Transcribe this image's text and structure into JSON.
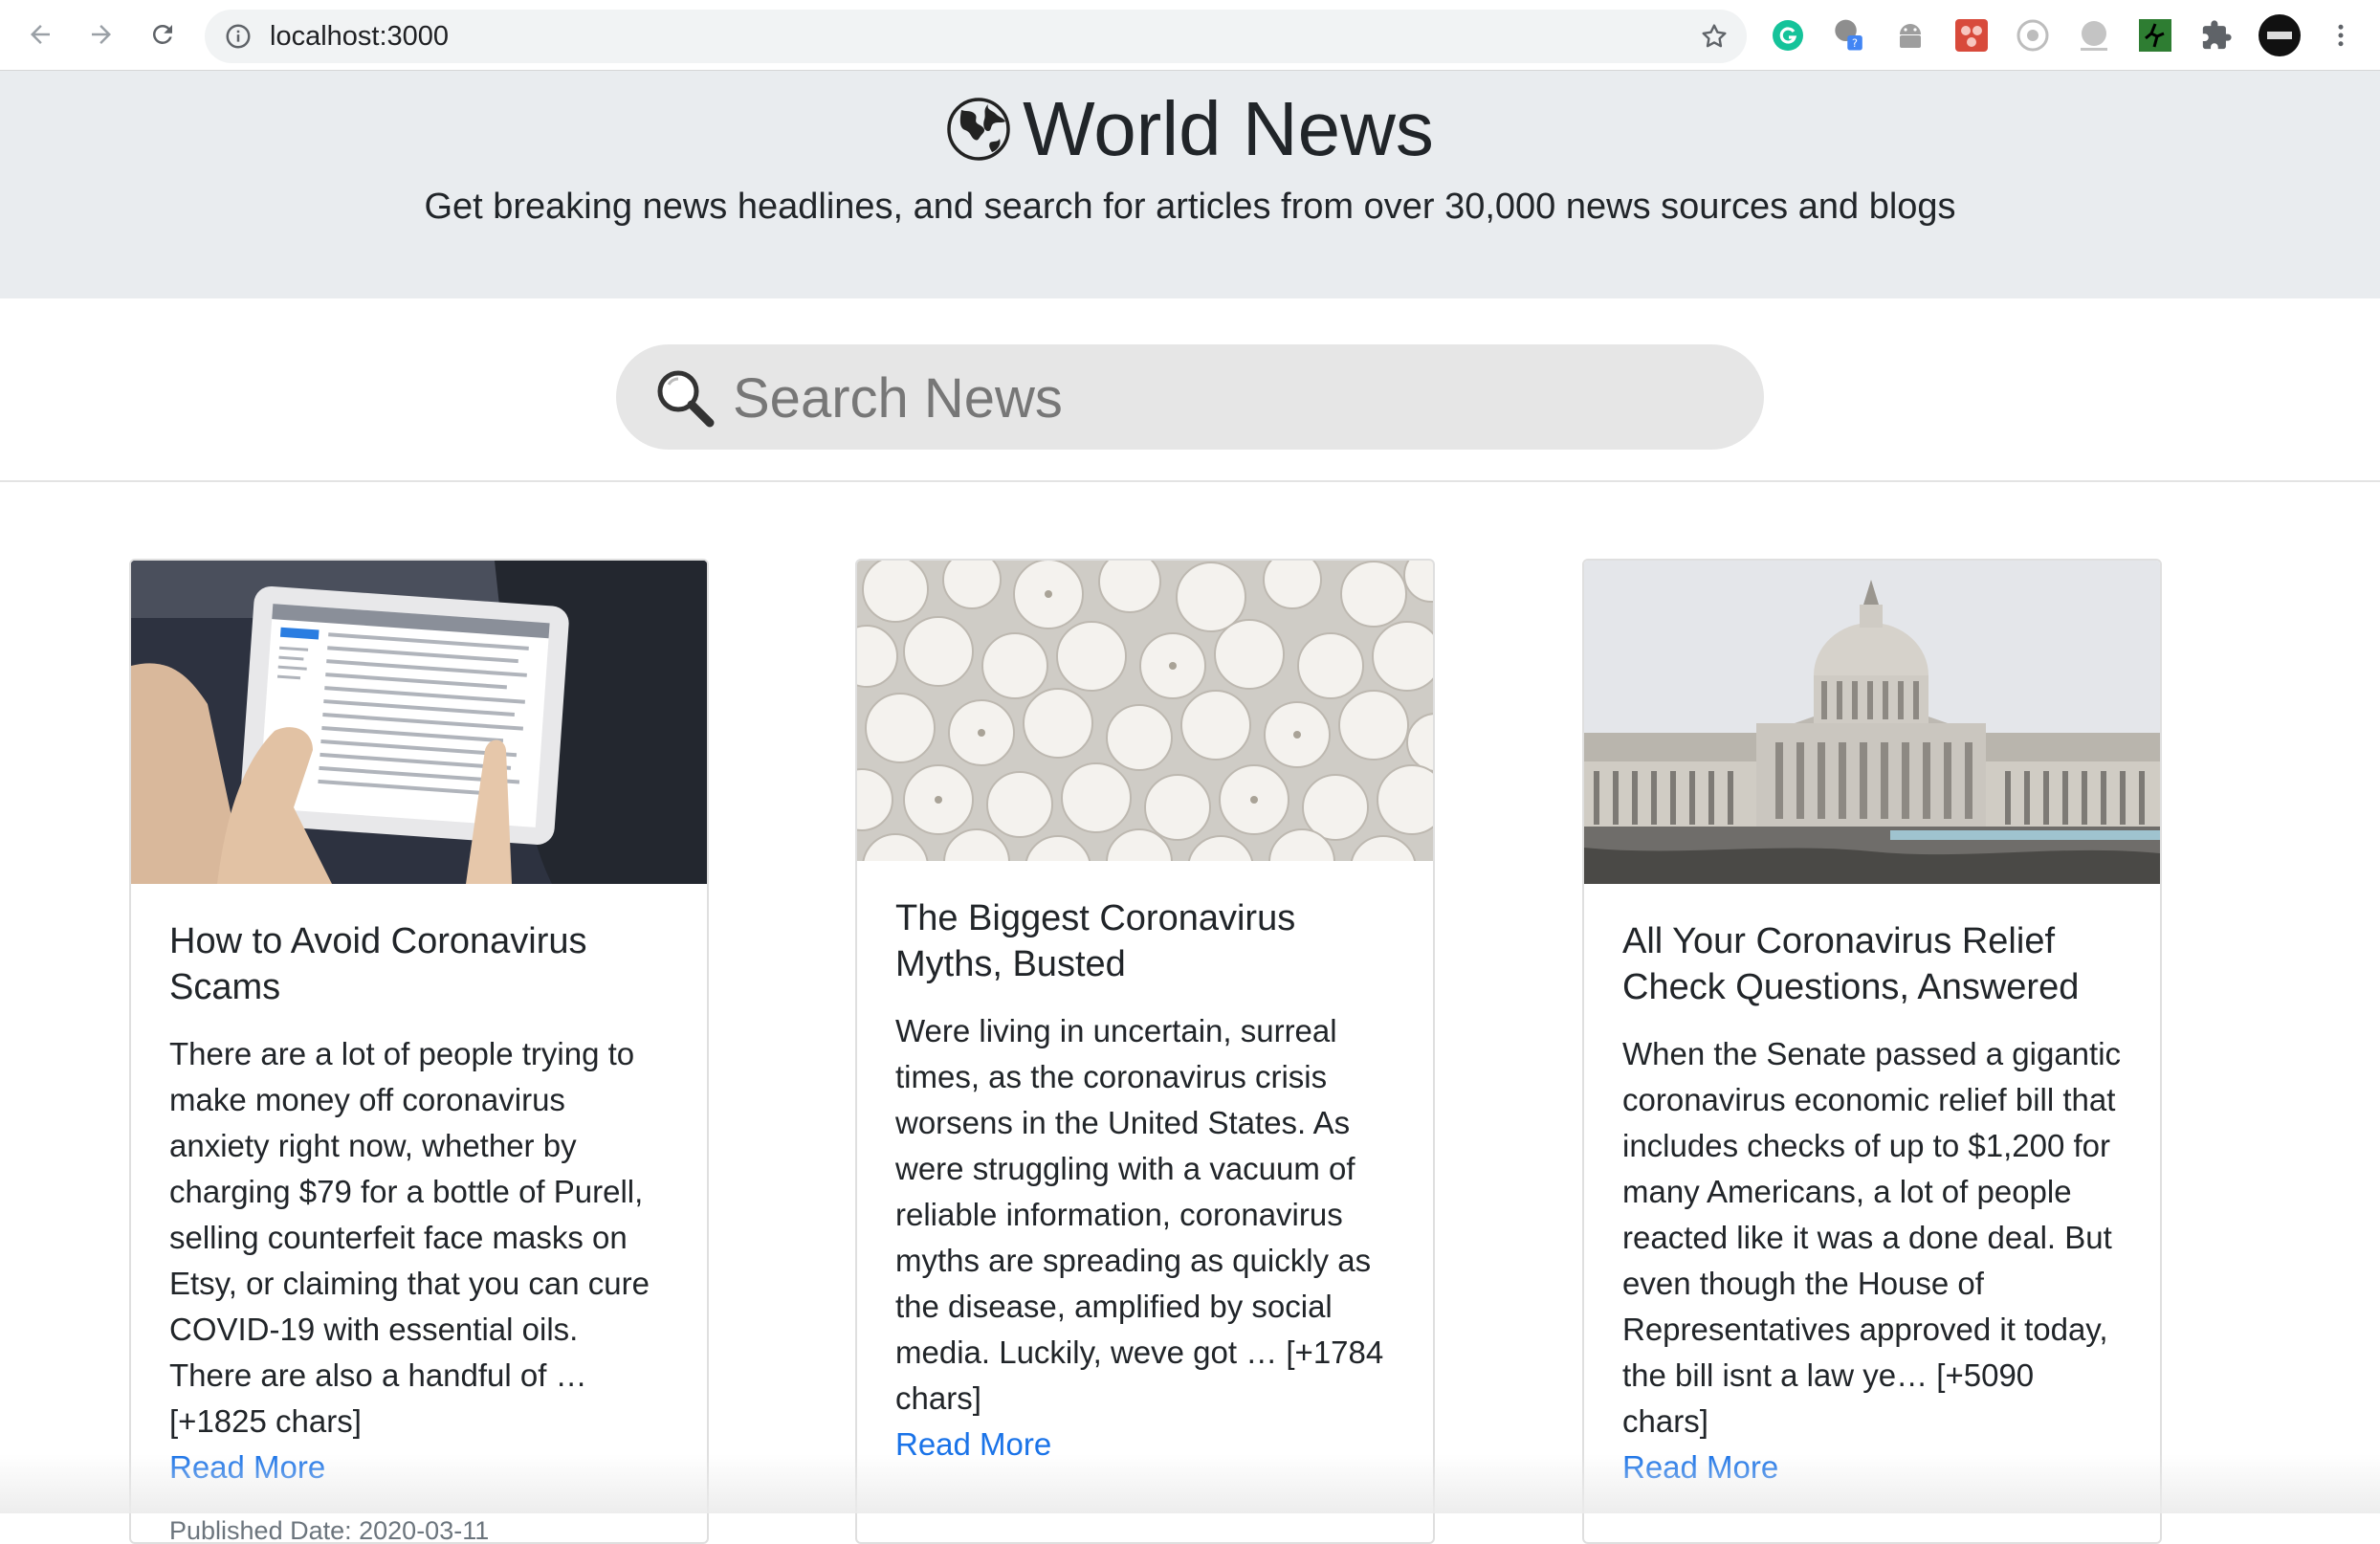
{
  "browser": {
    "url": "localhost:3000"
  },
  "header": {
    "title": "World News",
    "tagline": "Get breaking news headlines, and search for articles from over 30,000 news sources and blogs"
  },
  "search": {
    "placeholder": "Search News",
    "value": ""
  },
  "articles": [
    {
      "title": "How to Avoid Coronavirus Scams",
      "description": "There are a lot of people trying to make money off coronavirus anxiety right now, whether by charging $79 for a bottle of Purell, selling counterfeit face masks on Etsy, or claiming that you can cure COVID-19 with essential oils. There are also a handful of … [+1825 chars]",
      "link_label": "Read More",
      "published": "Published Date: 2020-03-11"
    },
    {
      "title": "The Biggest Coronavirus Myths, Busted",
      "description": "Were living in uncertain, surreal times, as the coronavirus crisis worsens in the United States. As were struggling with a vacuum of reliable information, coronavirus myths are spreading as quickly as the disease, amplified by social media. Luckily, weve got … [+1784 chars]",
      "link_label": "Read More",
      "published": ""
    },
    {
      "title": "All Your Coronavirus Relief Check Questions, Answered",
      "description": "When the Senate passed a gigantic coronavirus economic relief bill that includes checks of up to $1,200 for many Americans, a lot of people reacted like it was a done deal. But even though the House of Representatives approved it today, the bill isnt a law ye… [+5090 chars]",
      "link_label": "Read More",
      "published": ""
    }
  ],
  "colors": {
    "jumbotron": "#e9ecef",
    "link": "#1a73e8",
    "search_bg": "#e6e6e6"
  },
  "icons": [
    "back-arrow-icon",
    "forward-arrow-icon",
    "reload-icon",
    "info-icon",
    "star-icon",
    "globe-icon",
    "magnifier-icon",
    "puzzle-icon",
    "menu-dots-icon"
  ]
}
